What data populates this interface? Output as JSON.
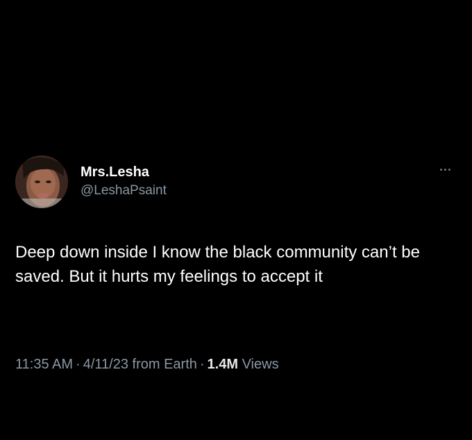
{
  "tweet": {
    "author": {
      "display_name": "Mrs.Lesha",
      "handle": "@LeshaPsaint"
    },
    "text": "Deep down inside I know the black community can’t be saved. But it hurts my feelings to accept it",
    "time": "11:35 AM",
    "separator": "·",
    "date": "4/11/23",
    "source": "from Earth",
    "views_count": "1.4M",
    "views_label": "Views"
  },
  "colors": {
    "background": "#000000",
    "primary_text": "#ffffff",
    "secondary_text": "#8b98a5"
  },
  "icons": {
    "more": "more-horizontal-icon",
    "avatar": "profile-photo"
  }
}
